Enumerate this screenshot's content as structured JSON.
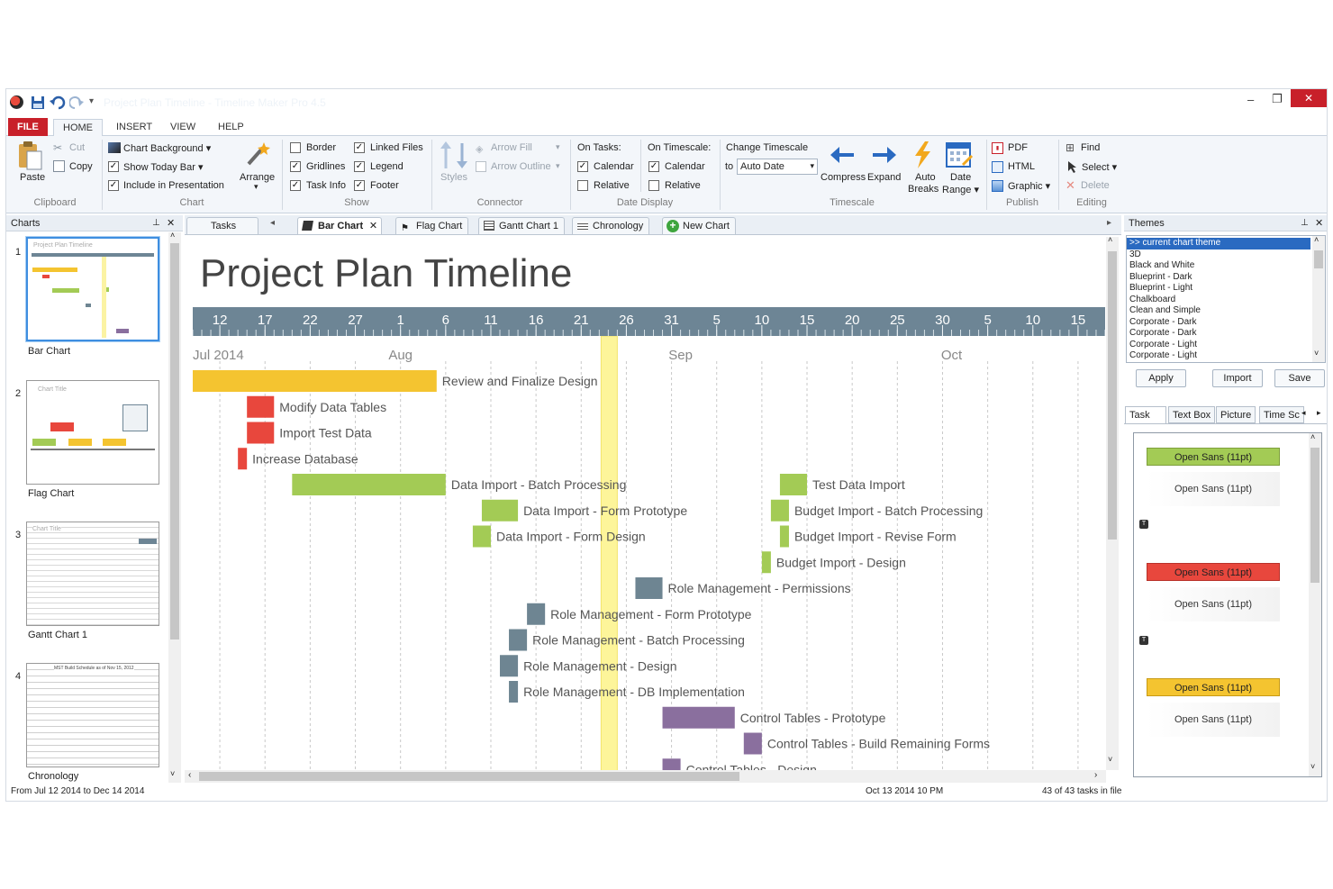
{
  "window": {
    "title_text": "Project Plan Timeline - Timeline Maker Pro 4.5",
    "minimize": "–",
    "maximize": "❐",
    "close": "✕"
  },
  "ribbon_tabs": [
    "FILE",
    "HOME",
    "INSERT",
    "VIEW",
    "HELP"
  ],
  "clipboard": {
    "paste": "Paste",
    "cut": "Cut",
    "copy": "Copy",
    "group": "Clipboard"
  },
  "chart_group": {
    "background": "Chart Background",
    "today_bar": "Show Today Bar",
    "presentation": "Include in Presentation",
    "arrange": "Arrange",
    "group": "Chart"
  },
  "show_group": {
    "border": "Border",
    "gridlines": "Gridlines",
    "task_info": "Task Info",
    "linked_files": "Linked Files",
    "legend": "Legend",
    "footer": "Footer",
    "group": "Show"
  },
  "connector": {
    "styles": "Styles",
    "arrow_fill": "Arrow Fill",
    "arrow_outline": "Arrow Outline",
    "group": "Connector"
  },
  "date_display": {
    "on_tasks": "On Tasks:",
    "on_timescale": "On Timescale:",
    "calendar": "Calendar",
    "relative": "Relative",
    "group": "Date Display"
  },
  "timescale": {
    "change": "Change Timescale",
    "to": "to",
    "auto_date": "Auto Date",
    "compress": "Compress",
    "expand": "Expand",
    "auto_breaks_1": "Auto",
    "auto_breaks_2": "Breaks",
    "date_range_1": "Date",
    "date_range_2": "Range",
    "group": "Timescale"
  },
  "publish": {
    "pdf": "PDF",
    "html": "HTML",
    "graphic": "Graphic",
    "group": "Publish"
  },
  "editing": {
    "find": "Find",
    "select": "Select",
    "delete": "Delete",
    "group": "Editing"
  },
  "charts_panel": {
    "title": "Charts",
    "items": [
      {
        "num": "1",
        "name": "Bar Chart",
        "thumb_title": "Project Plan Timeline"
      },
      {
        "num": "2",
        "name": "Flag Chart",
        "thumb_title": "Chart Title"
      },
      {
        "num": "3",
        "name": "Gantt Chart 1",
        "thumb_title": "Chart Title"
      },
      {
        "num": "4",
        "name": "Chronology",
        "thumb_title": "MST Build Schedule as of Nov 15, 2012"
      }
    ]
  },
  "doc_tabs": {
    "tasks": "Tasks",
    "bar_chart": "Bar Chart",
    "flag_chart": "Flag Chart",
    "gantt_chart": "Gantt Chart 1",
    "chronology": "Chronology",
    "new_chart": "New Chart"
  },
  "chart_data": {
    "type": "gantt",
    "title": "Project Plan Timeline",
    "x_start": "2014-07-09",
    "x_end": "2014-10-18",
    "week_ticks": [
      {
        "label": "12",
        "date": "2014-07-12"
      },
      {
        "label": "17",
        "date": "2014-07-17"
      },
      {
        "label": "22",
        "date": "2014-07-22"
      },
      {
        "label": "27",
        "date": "2014-07-27"
      },
      {
        "label": "1",
        "date": "2014-08-01"
      },
      {
        "label": "6",
        "date": "2014-08-06"
      },
      {
        "label": "11",
        "date": "2014-08-11"
      },
      {
        "label": "16",
        "date": "2014-08-16"
      },
      {
        "label": "21",
        "date": "2014-08-21"
      },
      {
        "label": "26",
        "date": "2014-08-26"
      },
      {
        "label": "31",
        "date": "2014-08-31"
      },
      {
        "label": "5",
        "date": "2014-09-05"
      },
      {
        "label": "10",
        "date": "2014-09-10"
      },
      {
        "label": "15",
        "date": "2014-09-15"
      },
      {
        "label": "20",
        "date": "2014-09-20"
      },
      {
        "label": "25",
        "date": "2014-09-25"
      },
      {
        "label": "30",
        "date": "2014-09-30"
      },
      {
        "label": "5",
        "date": "2014-10-05"
      },
      {
        "label": "10",
        "date": "2014-10-10"
      },
      {
        "label": "15",
        "date": "2014-10-15"
      }
    ],
    "months": [
      {
        "label": "Jul 2014",
        "date": "2014-07-09"
      },
      {
        "label": "Aug",
        "date": "2014-08-01"
      },
      {
        "label": "Sep",
        "date": "2014-09-01"
      },
      {
        "label": "Oct",
        "date": "2014-10-01"
      }
    ],
    "today": "2014-08-24",
    "tasks": [
      {
        "name": "Review and Finalize Design",
        "start": "2014-07-09",
        "end": "2014-08-05",
        "color": "#f4c430"
      },
      {
        "name": "Modify Data Tables",
        "start": "2014-07-15",
        "end": "2014-07-18",
        "color": "#e8473d"
      },
      {
        "name": "Import Test Data",
        "start": "2014-07-15",
        "end": "2014-07-18",
        "color": "#e8473d"
      },
      {
        "name": "Increase Database",
        "start": "2014-07-14",
        "end": "2014-07-15",
        "color": "#e8473d"
      },
      {
        "name": "Data Import - Batch Processing",
        "start": "2014-07-20",
        "end": "2014-08-06",
        "color": "#a3cb55"
      },
      {
        "name": "Data Import - Form Prototype",
        "start": "2014-08-10",
        "end": "2014-08-14",
        "color": "#a3cb55"
      },
      {
        "name": "Data Import - Form Design",
        "start": "2014-08-09",
        "end": "2014-08-11",
        "color": "#a3cb55"
      },
      {
        "name": "Test Data Import",
        "start": "2014-09-12",
        "end": "2014-09-15",
        "color": "#a3cb55"
      },
      {
        "name": "Budget Import  - Batch Processing",
        "start": "2014-09-11",
        "end": "2014-09-13",
        "color": "#a3cb55"
      },
      {
        "name": "Budget Import - Revise Form",
        "start": "2014-09-12",
        "end": "2014-09-13",
        "color": "#a3cb55"
      },
      {
        "name": "Budget Import - Design",
        "start": "2014-09-10",
        "end": "2014-09-11",
        "color": "#a3cb55"
      },
      {
        "name": "Role Management - Permissions",
        "start": "2014-08-27",
        "end": "2014-08-30",
        "color": "#6e8592"
      },
      {
        "name": "Role Management - Form Prototype",
        "start": "2014-08-15",
        "end": "2014-08-17",
        "color": "#6e8592"
      },
      {
        "name": "Role Management - Batch Processing",
        "start": "2014-08-13",
        "end": "2014-08-15",
        "color": "#6e8592"
      },
      {
        "name": "Role Management - Design",
        "start": "2014-08-12",
        "end": "2014-08-14",
        "color": "#6e8592"
      },
      {
        "name": "Role Management - DB Implementation",
        "start": "2014-08-13",
        "end": "2014-08-14",
        "color": "#6e8592"
      },
      {
        "name": "Control Tables - Prototype",
        "start": "2014-08-30",
        "end": "2014-09-07",
        "color": "#8a6f9e"
      },
      {
        "name": "Control Tables - Build Remaining Forms",
        "start": "2014-09-08",
        "end": "2014-09-10",
        "color": "#8a6f9e"
      },
      {
        "name": "Control Tables - Design",
        "start": "2014-08-30",
        "end": "2014-09-01",
        "color": "#8a6f9e"
      }
    ]
  },
  "themes_panel": {
    "title": "Themes",
    "items": [
      ">> current chart theme",
      "3D",
      "Black and White",
      "Blueprint - Dark",
      "Blueprint - Light",
      "Chalkboard",
      "Clean and Simple",
      "Corporate - Dark",
      "Corporate - Dark",
      "Corporate - Light",
      "Corporate - Light"
    ],
    "apply": "Apply",
    "import": "Import",
    "save": "Save"
  },
  "style_tabs": [
    "Task",
    "Text Box",
    "Picture",
    "Time Sc"
  ],
  "style_swatches": [
    {
      "label": "Open Sans (11pt)",
      "color": "#a3cb55",
      "plain": "Open Sans (11pt)"
    },
    {
      "label": "Open Sans (11pt)",
      "color": "#e8473d",
      "plain": "Open Sans (11pt)"
    },
    {
      "label": "Open Sans (11pt)",
      "color": "#f4c430",
      "plain": "Open Sans (11pt)"
    }
  ],
  "status_bar": {
    "range": "From Jul 12 2014  to Dec 14 2014",
    "datetime": "Oct 13 2014 10 PM",
    "count": "43 of 43 tasks in file"
  }
}
